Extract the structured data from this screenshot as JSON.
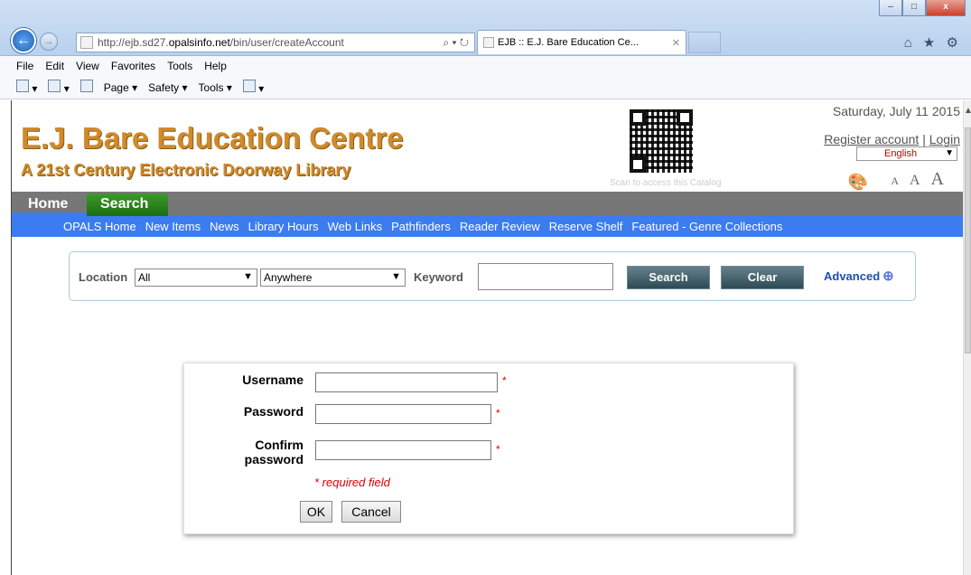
{
  "browser": {
    "url_prefix": "http://ejb.sd27.",
    "url_domain": "opalsinfo.net",
    "url_path": "/bin/user/createAccount",
    "url_tools": "⌕ ▾ ↻",
    "tab_title": "EJB :: E.J. Bare Education Ce...",
    "tab_close": "✕",
    "menu": [
      "File",
      "Edit",
      "View",
      "Favorites",
      "Tools",
      "Help"
    ],
    "commands": [
      "▾",
      "▾",
      "Page ▾",
      "Safety ▾",
      "Tools ▾",
      "▾"
    ],
    "right_icons": "⌂ ★ ⚙",
    "win_min": "–",
    "win_max": "□",
    "win_close": "x"
  },
  "header": {
    "title": "E.J. Bare Education Centre",
    "subtitle": "A 21st Century Electronic Doorway Library",
    "qr_caption": "Scan to access this Catalog",
    "date": "Saturday, July 11 2015",
    "register": "Register account",
    "separator": "|",
    "login": "Login",
    "language": "English",
    "font_sizes": [
      "A",
      "A",
      "A"
    ]
  },
  "tabs": {
    "home": "Home",
    "search": "Search"
  },
  "nav_links": [
    "OPALS Home",
    "New Items",
    "News",
    "Library Hours",
    "Web Links",
    "Pathfinders",
    "Reader Review",
    "Reserve Shelf",
    "Featured - Genre Collections"
  ],
  "search": {
    "location_label": "Location",
    "location_value": "All",
    "scope_value": "Anywhere",
    "keyword_label": "Keyword",
    "keyword_value": "",
    "search_button": "Search",
    "clear_button": "Clear",
    "advanced": "Advanced"
  },
  "form": {
    "username_label": "Username",
    "password_label": "Password",
    "confirm_label_1": "Confirm",
    "confirm_label_2": "password",
    "required_mark": "*",
    "required_note": "* required field",
    "ok": "OK",
    "cancel": "Cancel"
  },
  "colors": {
    "brand": "#d08a2a",
    "nav_blue": "#3b7cf0",
    "nav_gray": "#777777",
    "search_green": "#2a8a1f",
    "required_red": "#dd0000"
  }
}
